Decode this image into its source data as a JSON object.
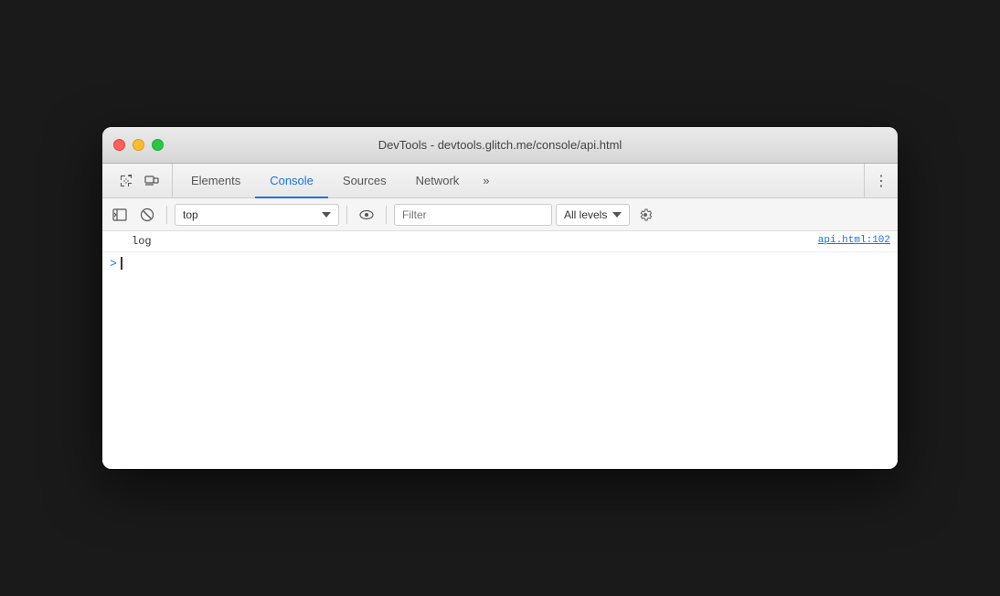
{
  "window": {
    "title": "DevTools - devtools.glitch.me/console/api.html"
  },
  "tabbar": {
    "tabs": [
      {
        "id": "elements",
        "label": "Elements",
        "active": false
      },
      {
        "id": "console",
        "label": "Console",
        "active": true
      },
      {
        "id": "sources",
        "label": "Sources",
        "active": false
      },
      {
        "id": "network",
        "label": "Network",
        "active": false
      }
    ],
    "more_label": "»",
    "menu_label": "⋮"
  },
  "console_toolbar": {
    "context_value": "top",
    "filter_placeholder": "Filter",
    "levels_label": "All levels"
  },
  "console_content": {
    "log_entry": {
      "text": "log",
      "source": "api.html:102"
    },
    "prompt_symbol": ">",
    "cursor": "|"
  }
}
